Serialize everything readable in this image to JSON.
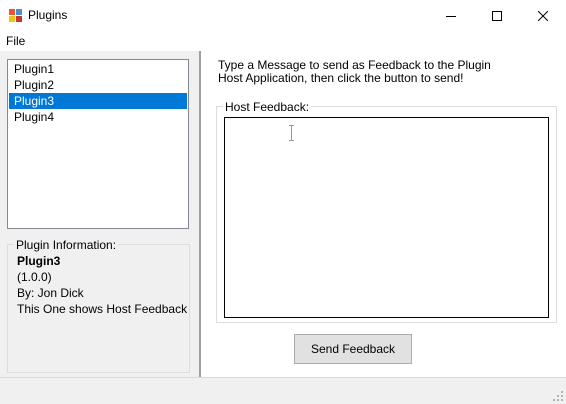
{
  "window": {
    "title": "Plugins"
  },
  "menu": {
    "file_label": "File"
  },
  "plugins": {
    "items": [
      "Plugin1",
      "Plugin2",
      "Plugin3",
      "Plugin4"
    ],
    "selected": "Plugin3"
  },
  "info": {
    "group_title": "Plugin Information:",
    "name": "Plugin3",
    "version": "(1.0.0)",
    "author": "By: Jon Dick",
    "description": "This One shows Host Feedback"
  },
  "feedback": {
    "instructions": "Type a Message to send as Feedback to the Plugin Host Application, then click the button to send!",
    "group_title": "Host Feedback:",
    "value": "",
    "send_label": "Send Feedback"
  },
  "colors": {
    "selection": "#0078d7",
    "window_bg": "#f0f0f0"
  },
  "icons": {
    "app": "plugins-app-icon",
    "minimize": "minimize-icon",
    "maximize": "maximize-icon",
    "close": "close-icon",
    "grip": "size-grip-icon"
  }
}
